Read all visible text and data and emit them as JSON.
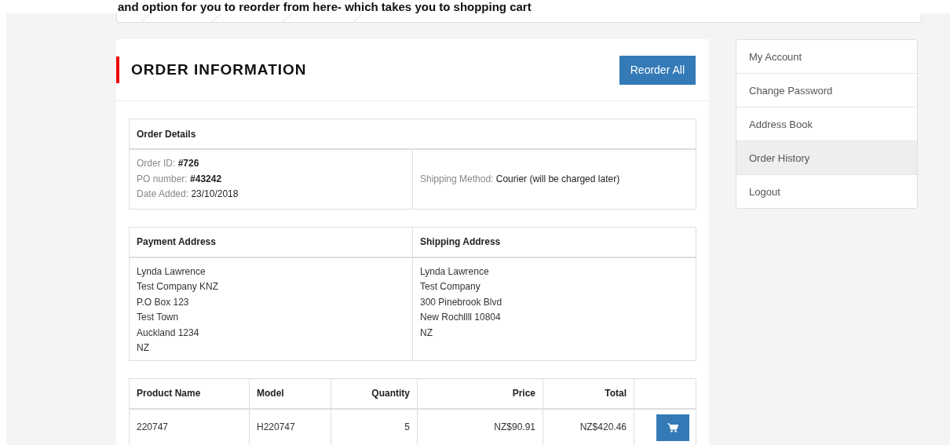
{
  "caption": "and option for you to reorder from here- which takes you to shopping cart",
  "panel": {
    "title": "ORDER INFORMATION",
    "reorder_button": "Reorder All"
  },
  "order_details": {
    "heading": "Order Details",
    "fields": [
      {
        "label": "Order ID:",
        "value": "#726",
        "bold": true
      },
      {
        "label": "PO number:",
        "value": "#43242",
        "bold": true
      },
      {
        "label": "Date Added:",
        "value": "23/10/2018",
        "bold": false
      }
    ],
    "shipping_method": {
      "label": "Shipping Method:",
      "value": "Courier (will be charged later)"
    }
  },
  "addresses": [
    {
      "heading": "Payment Address",
      "lines": [
        "Lynda Lawrence",
        "Test Company KNZ",
        "P.O Box 123",
        "Test Town",
        "Auckland 1234",
        "NZ"
      ]
    },
    {
      "heading": "Shipping Address",
      "lines": [
        "Lynda Lawrence",
        "Test Company",
        "300 Pinebrook Blvd",
        "New Rochllll 10804",
        "NZ"
      ]
    }
  ],
  "products": {
    "columns": [
      {
        "label": "Product Name",
        "numeric": false
      },
      {
        "label": "Model",
        "numeric": false
      },
      {
        "label": "Quantity",
        "numeric": true
      },
      {
        "label": "Price",
        "numeric": true
      },
      {
        "label": "Total",
        "numeric": true
      }
    ],
    "rows": [
      {
        "cells": [
          "220747",
          "H220747",
          "5",
          "NZ$90.91",
          "NZ$420.46"
        ]
      }
    ]
  },
  "sidebar": {
    "items": [
      {
        "label": "My Account",
        "selected": false
      },
      {
        "label": "Change Password",
        "selected": false
      },
      {
        "label": "Address Book",
        "selected": false
      },
      {
        "label": "Order History",
        "selected": true
      },
      {
        "label": "Logout",
        "selected": false
      }
    ]
  }
}
